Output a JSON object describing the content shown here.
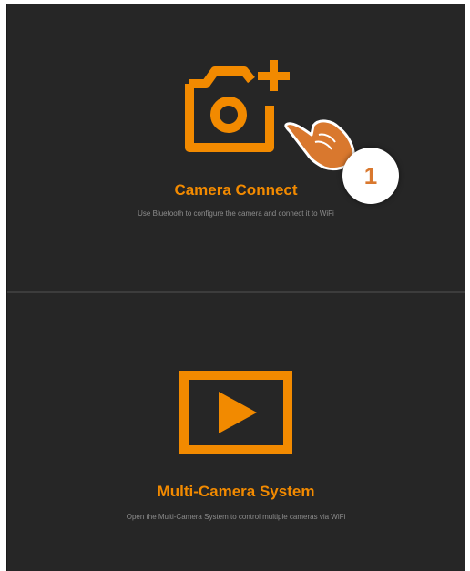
{
  "options": {
    "camera_connect": {
      "icon": "camera-add-icon",
      "title": "Camera Connect",
      "description": "Use Bluetooth to configure the camera and connect it to WiFi"
    },
    "multi_camera": {
      "icon": "play-screen-icon",
      "title": "Multi-Camera System",
      "description": "Open the Multi-Camera System to control multiple cameras via WiFi"
    }
  },
  "annotation": {
    "hand_icon": "pointing-hand-icon",
    "step_number": "1"
  },
  "colors": {
    "background": "#262626",
    "accent": "#f28a00",
    "text_muted": "#8c8c8c",
    "hand": "#d9782e"
  }
}
